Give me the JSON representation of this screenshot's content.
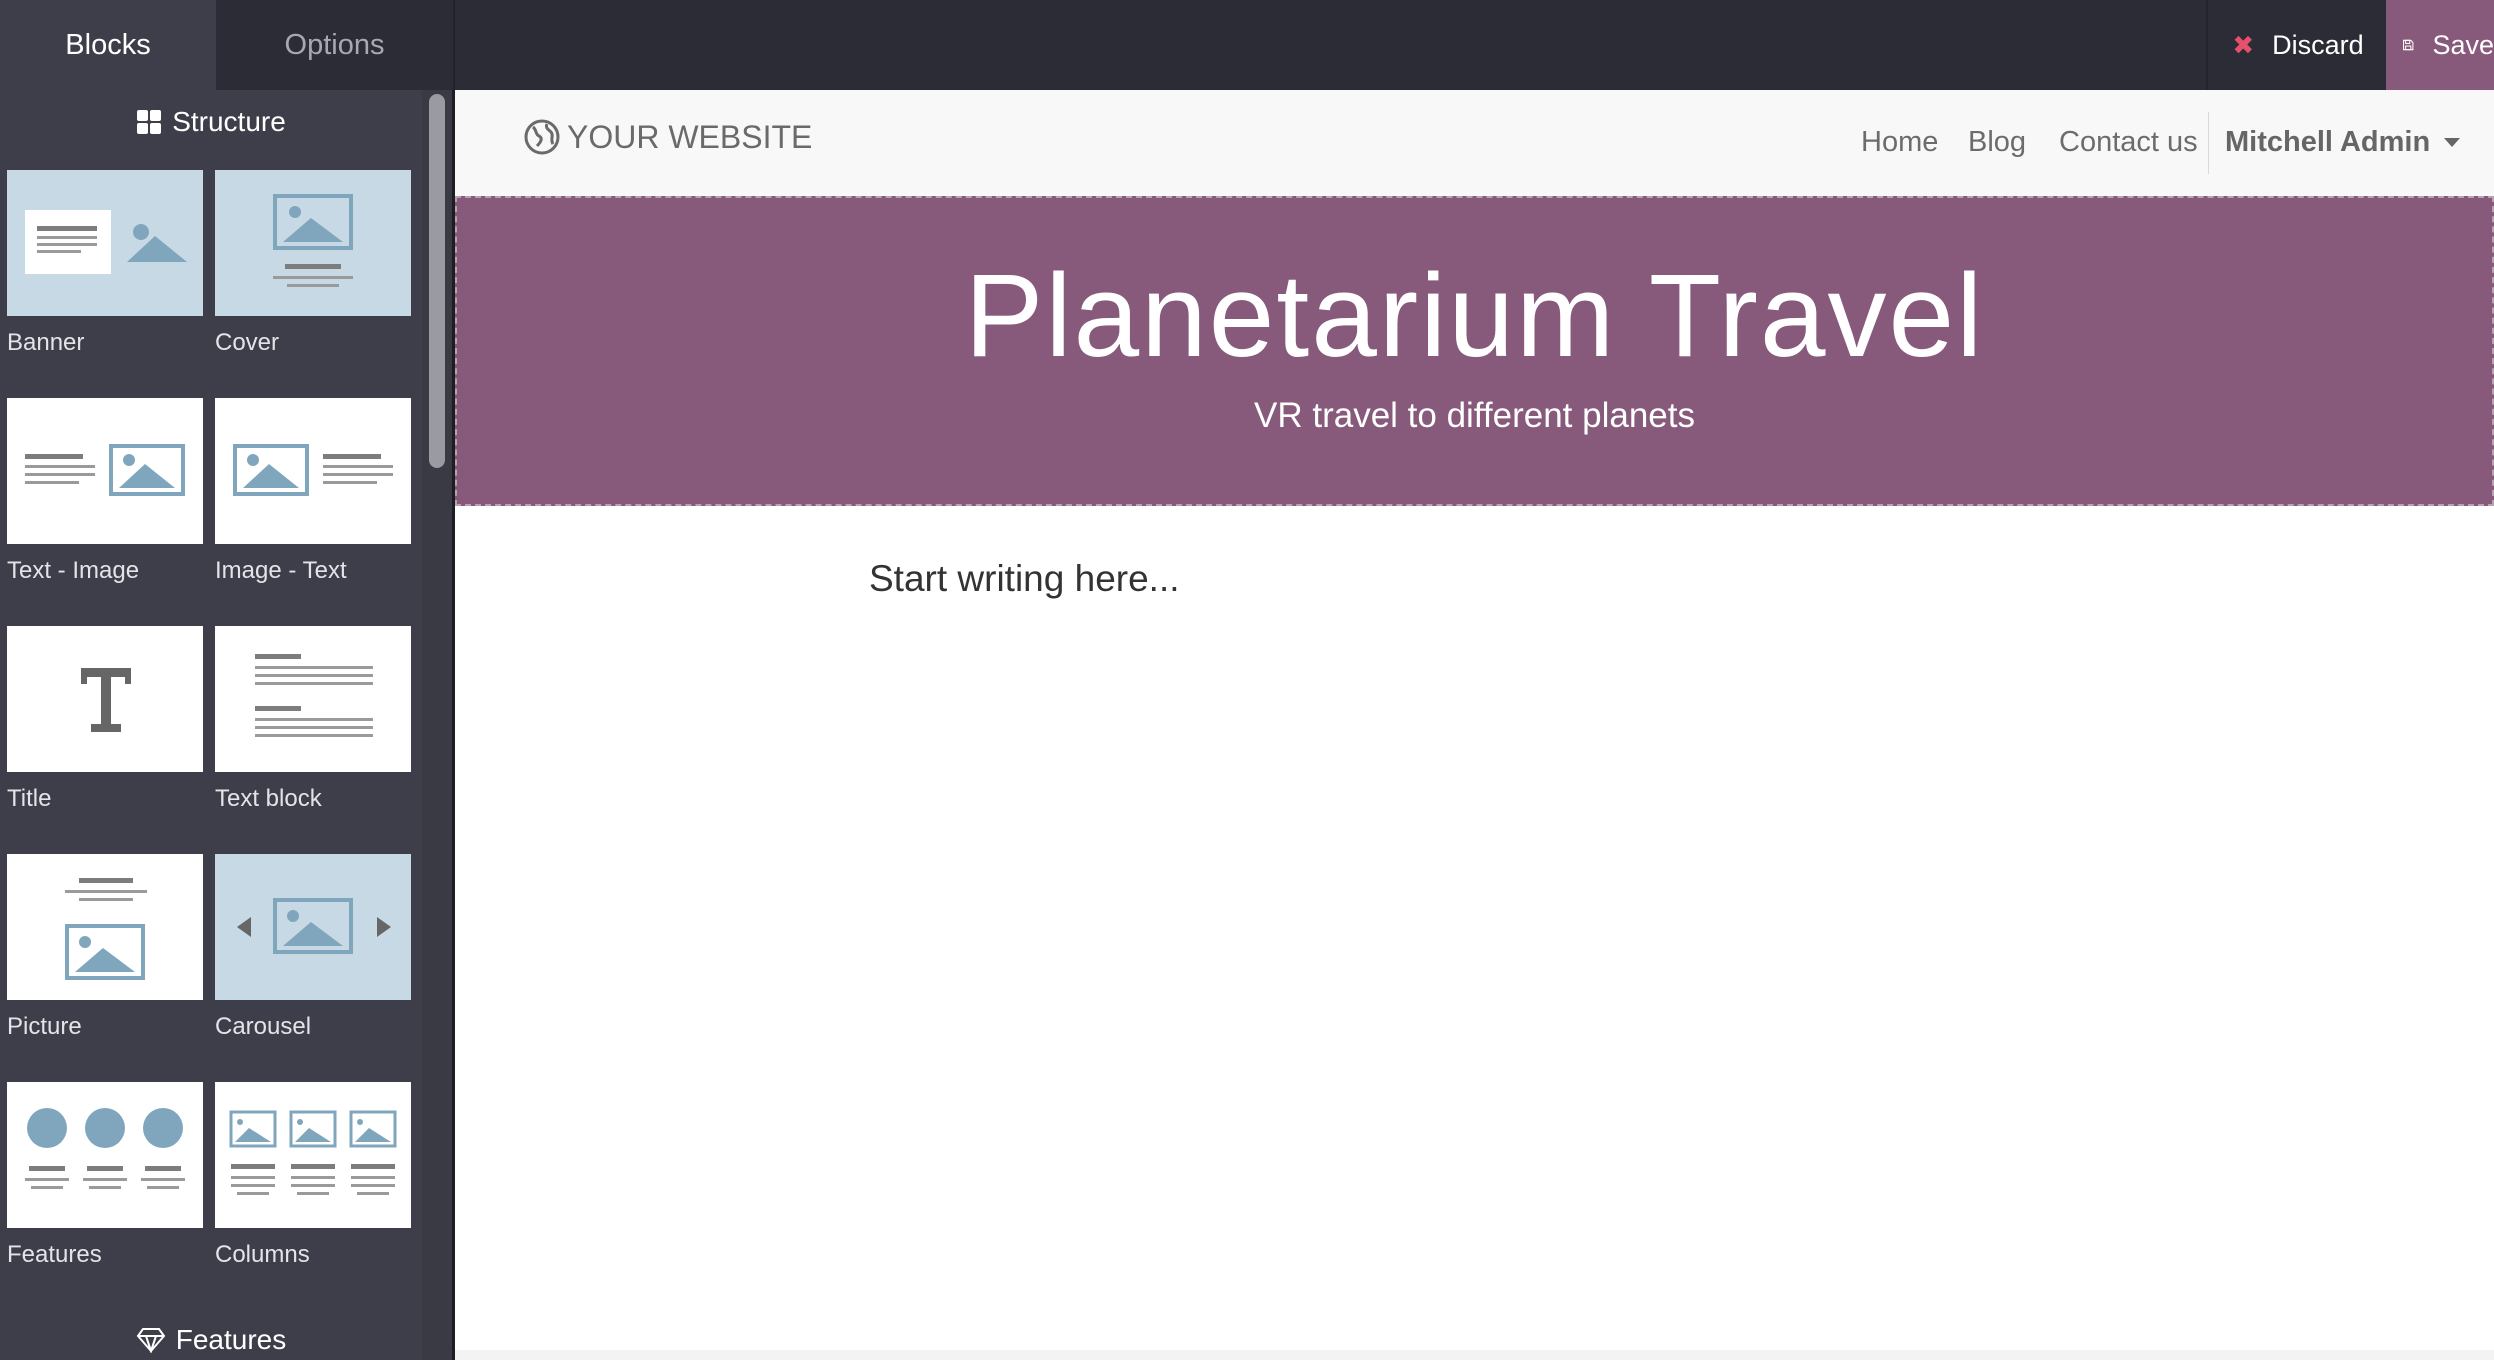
{
  "topbar": {
    "tabs": [
      {
        "label": "Blocks"
      },
      {
        "label": "Options"
      }
    ],
    "discard_label": "Discard",
    "save_label": "Save"
  },
  "sidebar": {
    "sections": [
      {
        "title": "Structure",
        "icon": "grid-icon"
      },
      {
        "title": "Features",
        "icon": "diamond-icon"
      }
    ],
    "blocks": [
      {
        "label": "Banner"
      },
      {
        "label": "Cover"
      },
      {
        "label": "Text - Image"
      },
      {
        "label": "Image - Text"
      },
      {
        "label": "Title"
      },
      {
        "label": "Text block"
      },
      {
        "label": "Picture"
      },
      {
        "label": "Carousel"
      },
      {
        "label": "Features"
      },
      {
        "label": "Columns"
      }
    ]
  },
  "site": {
    "logo_text": "YOUR WEBSITE",
    "nav": [
      {
        "label": "Home"
      },
      {
        "label": "Blog"
      },
      {
        "label": "Contact us"
      }
    ],
    "user_name": "Mitchell Admin",
    "banner_title": "Planetarium Travel",
    "banner_subtitle": "VR travel to different planets",
    "body_placeholder": "Start writing here..."
  },
  "colors": {
    "brand": "#875a7b",
    "topbar_bg": "#2c2c36",
    "sidebar_bg": "#3e3e4a",
    "thumb_blue": "#c6d9e4",
    "icon_blue": "#7fa6bd",
    "discard_x": "#e5506d"
  }
}
